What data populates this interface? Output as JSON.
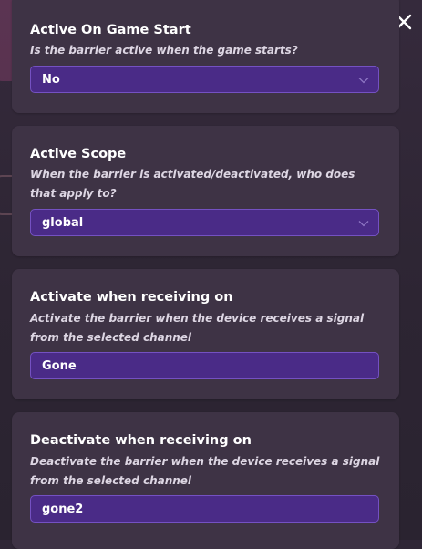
{
  "colors": {
    "overlay_background": "#2f2636",
    "card_background": "#3e3345",
    "field_background": "#4a2b87",
    "field_border": "#7451c2",
    "title_text": "#ffffff",
    "description_text": "#ddd6e3"
  },
  "icons": {
    "close": "close-icon",
    "dropdown": "chevron-down-icon"
  },
  "settings": {
    "active_on_game_start": {
      "title": "Active On Game Start",
      "description": "Is the barrier active when the game starts?",
      "value": "No"
    },
    "active_scope": {
      "title": "Active Scope",
      "description": "When the barrier is activated/deactivated, who does that apply to?",
      "value": "global"
    },
    "activate_channel": {
      "title": "Activate when receiving on",
      "description": "Activate the barrier when the device receives a signal from the selected channel",
      "value": "Gone"
    },
    "deactivate_channel": {
      "title": "Deactivate when receiving on",
      "description": "Deactivate the barrier when the device receives a signal from the selected channel",
      "value": "gone2"
    }
  }
}
